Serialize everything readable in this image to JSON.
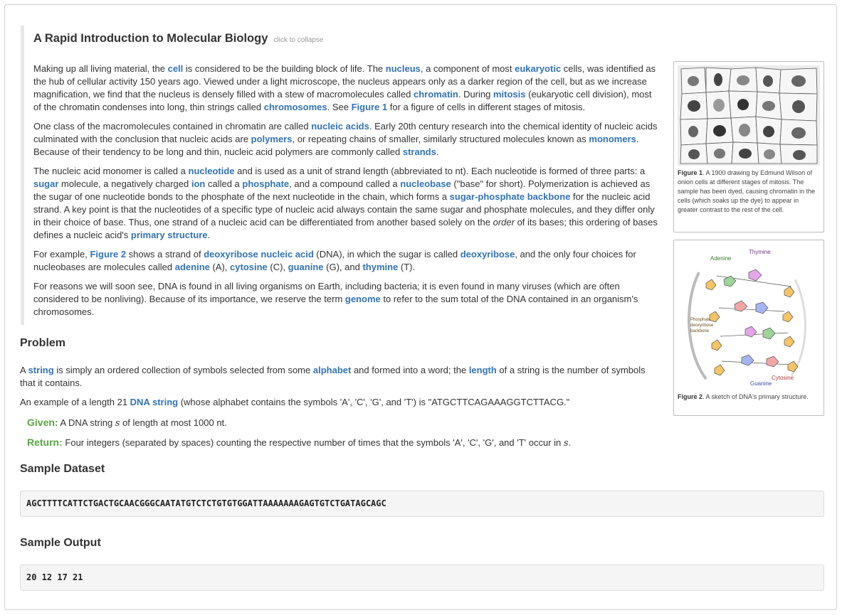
{
  "intro": {
    "title": "A Rapid Introduction to Molecular Biology",
    "collapse": "click to collapse",
    "p1": [
      "Making up all living material, the ",
      "cell",
      " is considered to be the building block of life. The ",
      "nucleus",
      ", a component of most ",
      "eukaryotic",
      " cells, was identified as the hub of cellular activity 150 years ago. Viewed under a light microscope, the nucleus appears only as a darker region of the cell, but as we increase magnification, we find that the nucleus is densely filled with a stew of macromolecules called ",
      "chromatin",
      ". During ",
      "mitosis",
      " (eukaryotic cell division), most of the chromatin condenses into long, thin strings called ",
      "chromosomes",
      ". See ",
      "Figure 1",
      " for a figure of cells in different stages of mitosis."
    ],
    "p2": [
      "One class of the macromolecules contained in chromatin are called ",
      "nucleic acids",
      ". Early 20th century research into the chemical identity of nucleic acids culminated with the conclusion that nucleic acids are ",
      "polymers",
      ", or repeating chains of smaller, similarly structured molecules known as ",
      "monomers",
      ". Because of their tendency to be long and thin, nucleic acid polymers are commonly called ",
      "strands",
      "."
    ],
    "p3": [
      "The nucleic acid monomer is called a ",
      "nucleotide",
      " and is used as a unit of strand length (abbreviated to nt). Each nucleotide is formed of three parts: a ",
      "sugar",
      " molecule, a negatively charged ",
      "ion",
      " called a ",
      "phosphate",
      ", and a compound called a ",
      "nucleobase",
      " (\"base\" for short). Polymerization is achieved as the sugar of one nucleotide bonds to the phosphate of the next nucleotide in the chain, which forms a ",
      "sugar-phosphate backbone",
      " for the nucleic acid strand. A key point is that the nucleotides of a specific type of nucleic acid always contain the same sugar and phosphate molecules, and they differ only in their choice of base. Thus, one strand of a nucleic acid can be differentiated from another based solely on the ",
      "order",
      " of its bases; this ordering of bases defines a nucleic acid's ",
      "primary structure",
      "."
    ],
    "p4": [
      "For example, ",
      "Figure 2",
      " shows a strand of ",
      "deoxyribose nucleic acid",
      " (DNA), in which the sugar is called ",
      "deoxyribose",
      ", and the only four choices for nucleobases are molecules called ",
      "adenine",
      " (A), ",
      "cytosine",
      " (C), ",
      "guanine",
      " (G), and ",
      "thymine",
      " (T)."
    ],
    "p5": [
      "For reasons we will soon see, DNA is found in all living organisms on Earth, including bacteria; it is even found in many viruses (which are often considered to be nonliving). Because of its importance, we reserve the term ",
      "genome",
      " to refer to the sum total of the DNA contained in an organism's chromosomes."
    ]
  },
  "figure1": {
    "label": "Figure 1",
    "caption": ". A 1900 drawing by Edmund Wilson of onion cells at different stages of mitosis. The sample has been dyed, causing chromatin in the cells (which soaks up the dye) to appear in greater contrast to the rest of the cell."
  },
  "figure2": {
    "label": "Figure 2",
    "caption": ". A sketch of DNA's primary structure.",
    "labels": {
      "thymine": "Thymine",
      "adenine": "Adenine",
      "backbone1": "Phosphate-",
      "backbone2": "deoxyribose",
      "backbone3": "backbone",
      "cytosine": "Cytosine",
      "guanine": "Guanine"
    }
  },
  "problem": {
    "heading": "Problem",
    "p1": [
      "A ",
      "string",
      " is simply an ordered collection of symbols selected from some ",
      "alphabet",
      " and formed into a word; the ",
      "length",
      " of a string is the number of symbols that it contains."
    ],
    "p2": [
      "An example of a length 21 ",
      "DNA string",
      " (whose alphabet contains the symbols 'A', 'C', 'G', and 'T') is \"ATGCTTCAGAAAGGTCTTACG.\""
    ],
    "given_label": "Given:",
    "given_text_a": " A DNA string ",
    "given_var": "s",
    "given_text_b": " of length at most 1000 nt.",
    "return_label": "Return:",
    "return_text": " Four integers (separated by spaces) counting the respective number of times that the symbols 'A', 'C', 'G', and 'T' occur in ",
    "return_var": "s",
    "return_end": "."
  },
  "sample_dataset": {
    "heading": "Sample Dataset",
    "value": "AGCTTTTCATTCTGACTGCAACGGGCAATATGTCTCTGTGTGGATTAAAAAAAGAGTGTCTGATAGCAGC"
  },
  "sample_output": {
    "heading": "Sample Output",
    "value": "20 12 17 21"
  }
}
